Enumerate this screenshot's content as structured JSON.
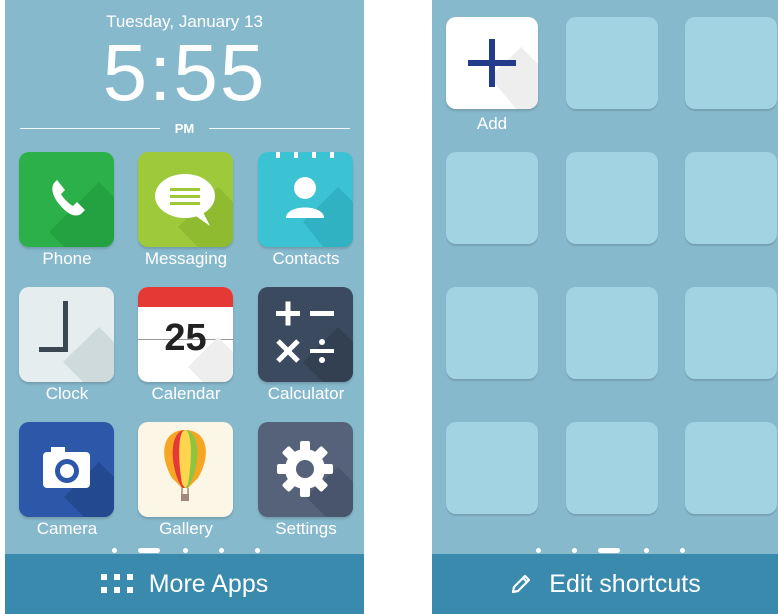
{
  "lock": {
    "date": "Tuesday, January 13",
    "time": "5:55",
    "ampm": "PM"
  },
  "apps": [
    {
      "label": "Phone",
      "icon": "phone-icon",
      "color": "#2bb04a"
    },
    {
      "label": "Messaging",
      "icon": "messaging-icon",
      "color": "#9dc93b"
    },
    {
      "label": "Contacts",
      "icon": "contacts-icon",
      "color": "#3cc3d3"
    },
    {
      "label": "Clock",
      "icon": "clock-icon",
      "color": "#e6edee"
    },
    {
      "label": "Calendar",
      "icon": "calendar-icon",
      "color": "#ffffff",
      "day": "25"
    },
    {
      "label": "Calculator",
      "icon": "calculator-icon",
      "color": "#3b4a5e"
    },
    {
      "label": "Camera",
      "icon": "camera-icon",
      "color": "#2d57a8"
    },
    {
      "label": "Gallery",
      "icon": "gallery-icon",
      "color": "#fbf6e6"
    },
    {
      "label": "Settings",
      "icon": "settings-icon",
      "color": "#55627a"
    }
  ],
  "left_bar": {
    "label": "More Apps"
  },
  "right": {
    "add_label": "Add"
  },
  "right_bar": {
    "label": "Edit shortcuts"
  }
}
